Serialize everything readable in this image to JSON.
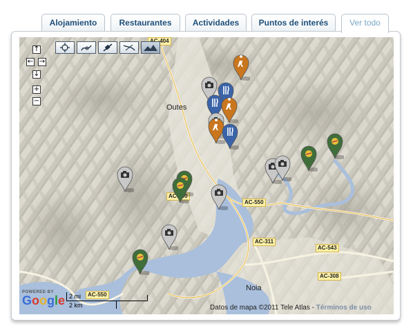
{
  "tabs": [
    {
      "label": "Alojamiento",
      "active": false
    },
    {
      "label": "Restaurantes",
      "active": false
    },
    {
      "label": "Actividades",
      "active": false
    },
    {
      "label": "Puntos de interés",
      "active": false
    },
    {
      "label": "Ver todo",
      "active": true
    }
  ],
  "map": {
    "controls": {
      "pan_up": "↑",
      "pan_left": "←",
      "pan_right": "→",
      "pan_down": "↓",
      "zoom_in": "+",
      "zoom_out": "−"
    },
    "map_types": [
      "center-icon",
      "map-icon",
      "satellite-icon",
      "hybrid-icon",
      "terrain-icon"
    ],
    "towns": [
      "Outes",
      "Noia"
    ],
    "roads": [
      "AC-404",
      "AC-550",
      "AC-550",
      "AC-311",
      "AC-543",
      "AC-308",
      "AC-550"
    ],
    "scale": {
      "miles": "2 mi",
      "km": "2 km"
    },
    "powered_by": "POWERED BY",
    "google_logo": "Google",
    "attribution": "Datos de mapa ©2011 Tele Atlas - ",
    "terms": "Términos de uso"
  },
  "colors": {
    "land": "#dedbd0",
    "water": "#a9bfdc",
    "tab_text": "#1f4f7a",
    "active_tab_text": "#7aa7c7",
    "marker_orange": "#c9761f",
    "marker_blue": "#3a63a8",
    "marker_gray": "#c8c8c8",
    "marker_green": "#3f6e3a"
  }
}
